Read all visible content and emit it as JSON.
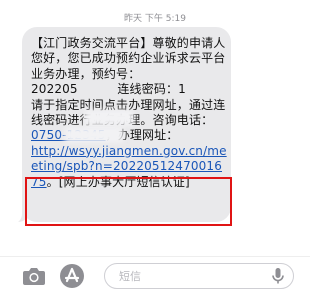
{
  "header": {
    "timestamp": "昨天 下午 5:19"
  },
  "message": {
    "text_part1": "【江门政务交流平台】尊敬的申请人您好，您已成功预约企业诉求云平台 业务办理，预约号：\n202205",
    "text_part2": "连线密码：1",
    "text_part3": "请于指定时间点击办理网址，通过连线密码进行业务办理。咨询电话：\n",
    "phone": "0750-12345",
    "text_part4": "，办理网址：\n",
    "link": "http://wsyy.jiangmen.gov.cn/meeting/spb?n=2022051247001675",
    "text_part5": "。[网上办事大厅短信认证]"
  },
  "composer": {
    "placeholder": "短信",
    "icons": [
      "camera-icon",
      "app-store-icon",
      "microphone-icon"
    ]
  },
  "colors": {
    "bubble": "#e9e9eb",
    "link": "#1a56b8",
    "highlight_box": "#e01414"
  }
}
